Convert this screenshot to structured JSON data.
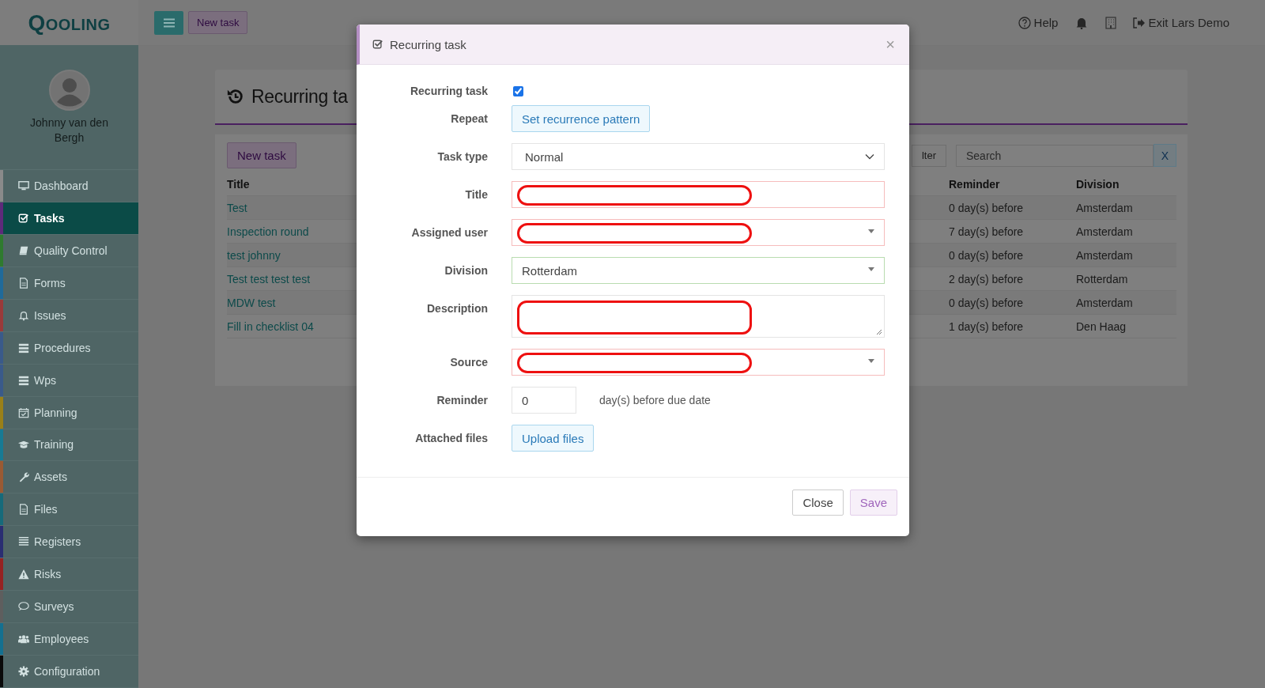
{
  "topbar": {
    "logo": "QOOLING",
    "new_task": "New task",
    "help": "Help",
    "exit": "Exit Lars Demo"
  },
  "sidebar": {
    "user": "Johnny van den Bergh",
    "items": [
      {
        "label": "Dashboard",
        "color": "#8a8a8a",
        "selected": false
      },
      {
        "label": "Tasks",
        "color": "#5e2a7a",
        "selected": true
      },
      {
        "label": "Quality Control",
        "color": "#2f7a2f",
        "selected": false
      },
      {
        "label": "Forms",
        "color": "#1f6a9a",
        "selected": false
      },
      {
        "label": "Issues",
        "color": "#9a3a3a",
        "selected": false
      },
      {
        "label": "Procedures",
        "color": "#3a5a8a",
        "selected": false
      },
      {
        "label": "Wps",
        "color": "#3a5a8a",
        "selected": false
      },
      {
        "label": "Planning",
        "color": "#9a8018",
        "selected": false
      },
      {
        "label": "Training",
        "color": "#177a94",
        "selected": false
      },
      {
        "label": "Assets",
        "color": "#9a5a33",
        "selected": false
      },
      {
        "label": "Files",
        "color": "#166a7a",
        "selected": false
      },
      {
        "label": "Registers",
        "color": "#2a2e72",
        "selected": false
      },
      {
        "label": "Risks",
        "color": "#962222",
        "selected": false
      },
      {
        "label": "Surveys",
        "color": "#5e5e5e",
        "selected": false
      },
      {
        "label": "Employees",
        "color": "#147090",
        "selected": false
      },
      {
        "label": "Configuration",
        "color": "#0a0a0a",
        "selected": false
      }
    ]
  },
  "page": {
    "title": "Recurring ta",
    "new_task": "New task",
    "filter": "lter",
    "search": {
      "placeholder": "Search"
    },
    "search_clear": "X",
    "columns": [
      "Title",
      "Reminder",
      "Division"
    ],
    "rows": [
      {
        "title": "Test",
        "reminder": "0 day(s) before",
        "division": "Amsterdam"
      },
      {
        "title": "Inspection round",
        "reminder": "7 day(s) before",
        "division": "Amsterdam"
      },
      {
        "title": "test johnny",
        "reminder": "0 day(s) before",
        "division": "Amsterdam"
      },
      {
        "title": "Test test test test",
        "reminder": "2 day(s) before",
        "division": "Rotterdam"
      },
      {
        "title": "MDW test",
        "reminder": "0 day(s) before",
        "division": "Amsterdam"
      },
      {
        "title": "Fill in checklist 04",
        "reminder": "1 day(s) before",
        "division": "Den Haag"
      }
    ]
  },
  "dialog": {
    "title": "Recurring task",
    "close_glyph": "×",
    "fields": [
      {
        "kind": "checkbox",
        "label": "Recurring task",
        "checked": true
      },
      {
        "kind": "button",
        "label": "Repeat",
        "button": "Set recurrence pattern"
      },
      {
        "kind": "select",
        "label": "Task type",
        "value": "Normal"
      },
      {
        "kind": "text",
        "label": "Title",
        "invalid": true,
        "redacted": true
      },
      {
        "kind": "combo",
        "label": "Assigned user",
        "invalid": true,
        "redacted": true
      },
      {
        "kind": "combo",
        "label": "Division",
        "value": "Rotterdam",
        "invalid": false
      },
      {
        "kind": "textarea",
        "label": "Description",
        "redacted": true
      },
      {
        "kind": "combo",
        "label": "Source",
        "invalid": true,
        "redacted": true
      },
      {
        "kind": "number",
        "label": "Reminder",
        "value": "0",
        "suffix": "day(s) before due date"
      },
      {
        "kind": "button",
        "label": "Attached files",
        "button": "Upload files"
      }
    ],
    "buttons": [
      "Close",
      "Save"
    ]
  }
}
